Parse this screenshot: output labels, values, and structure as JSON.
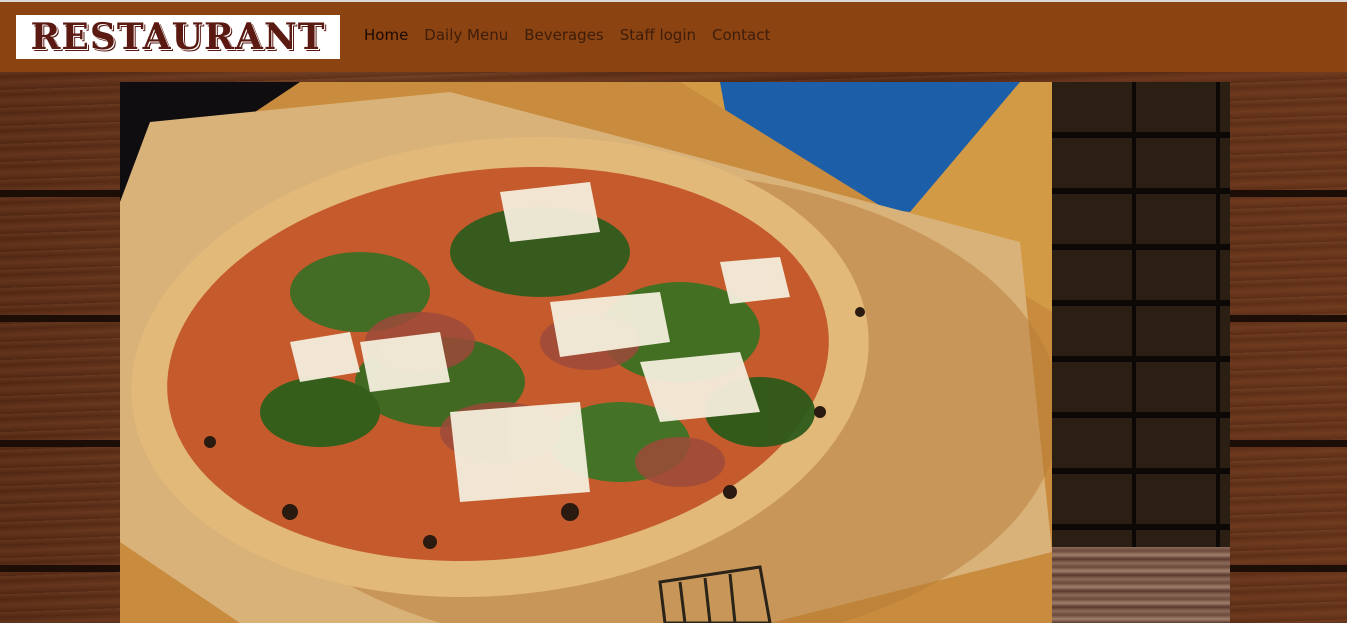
{
  "header": {
    "logo_text": "RESTAURANT",
    "nav": [
      {
        "label": "Home",
        "active": true
      },
      {
        "label": "Daily Menu",
        "active": false
      },
      {
        "label": "Beverages",
        "active": false
      },
      {
        "label": "Staff login",
        "active": false
      },
      {
        "label": "Contact",
        "active": false
      }
    ]
  },
  "colors": {
    "header_bg": "#8a4311",
    "nav_text": "#3e1d0a",
    "logo_text": "#5a1a12"
  }
}
